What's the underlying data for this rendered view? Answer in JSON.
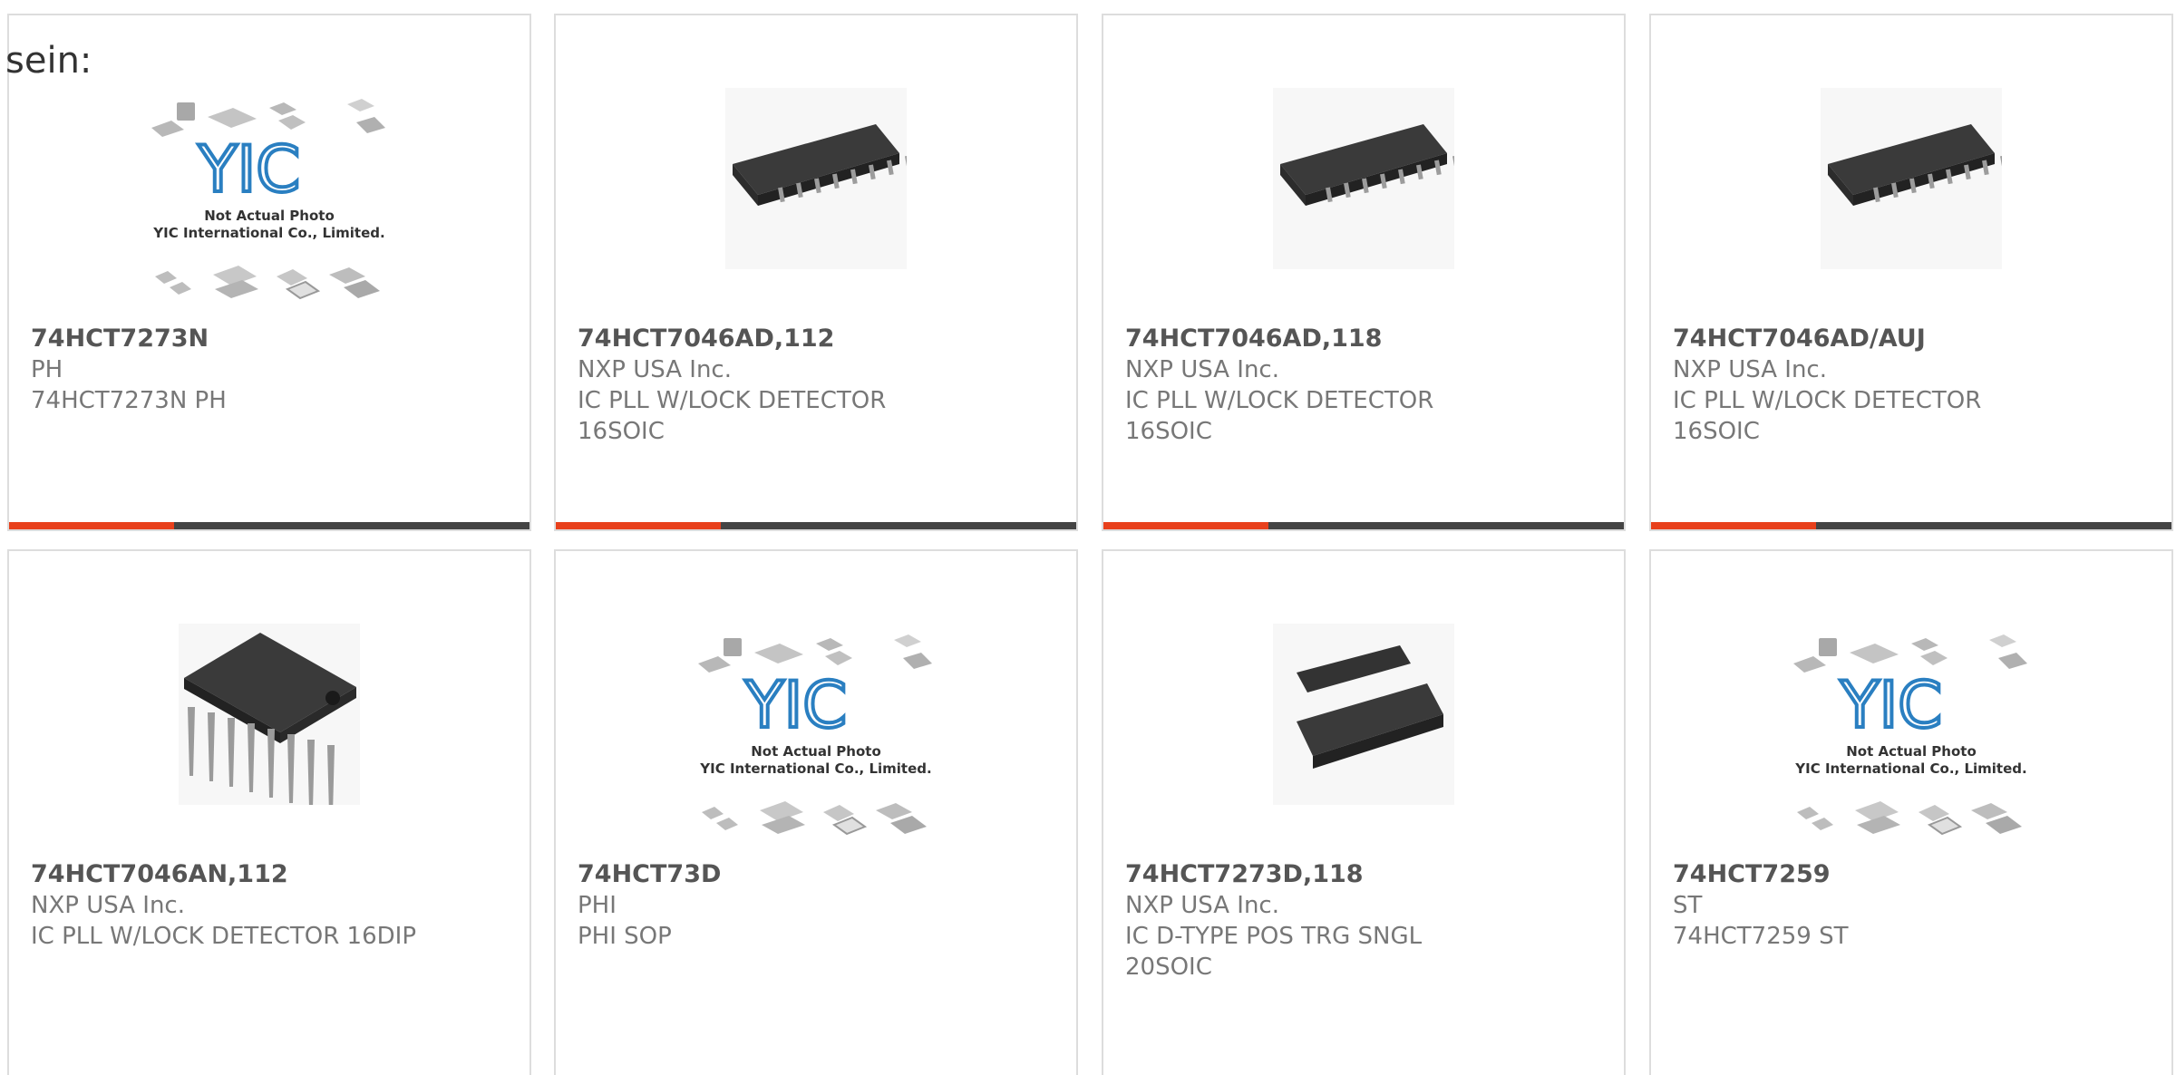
{
  "heading": "sein:",
  "colors": {
    "accent": "#e8401c",
    "bar": "#444444",
    "border": "#dddddd"
  },
  "products": [
    {
      "part_number": "74HCT7273N",
      "manufacturer": "PH",
      "description": "74HCT7273N PH",
      "image": "placeholder-logo",
      "logo_text": "YIC",
      "caption_1": "Not Actual Photo",
      "caption_2": "YIC International Co., Limited."
    },
    {
      "part_number": "74HCT7046AD,112",
      "manufacturer": "NXP USA Inc.",
      "description": "IC PLL W/LOCK DETECTOR 16SOIC",
      "image": "soic-chip"
    },
    {
      "part_number": "74HCT7046AD,118",
      "manufacturer": "NXP USA Inc.",
      "description": "IC PLL W/LOCK DETECTOR 16SOIC",
      "image": "soic-chip"
    },
    {
      "part_number": "74HCT7046AD/AUJ",
      "manufacturer": "NXP USA Inc.",
      "description": "IC PLL W/LOCK DETECTOR 16SOIC",
      "image": "soic-chip"
    },
    {
      "part_number": "74HCT7046AN,112",
      "manufacturer": "NXP USA Inc.",
      "description": "IC PLL W/LOCK DETECTOR 16DIP",
      "image": "dip-chip"
    },
    {
      "part_number": "74HCT73D",
      "manufacturer": "PHI",
      "description": "PHI SOP",
      "image": "placeholder-logo",
      "logo_text": "YIC",
      "caption_1": "Not Actual Photo",
      "caption_2": "YIC International Co., Limited."
    },
    {
      "part_number": "74HCT7273D,118",
      "manufacturer": "NXP USA Inc.",
      "description": "IC D-TYPE POS TRG SNGL 20SOIC",
      "image": "soic20-chips"
    },
    {
      "part_number": "74HCT7259",
      "manufacturer": "ST",
      "description": "74HCT7259 ST",
      "image": "placeholder-logo",
      "logo_text": "YIC",
      "caption_1": "Not Actual Photo",
      "caption_2": "YIC International Co., Limited."
    }
  ]
}
